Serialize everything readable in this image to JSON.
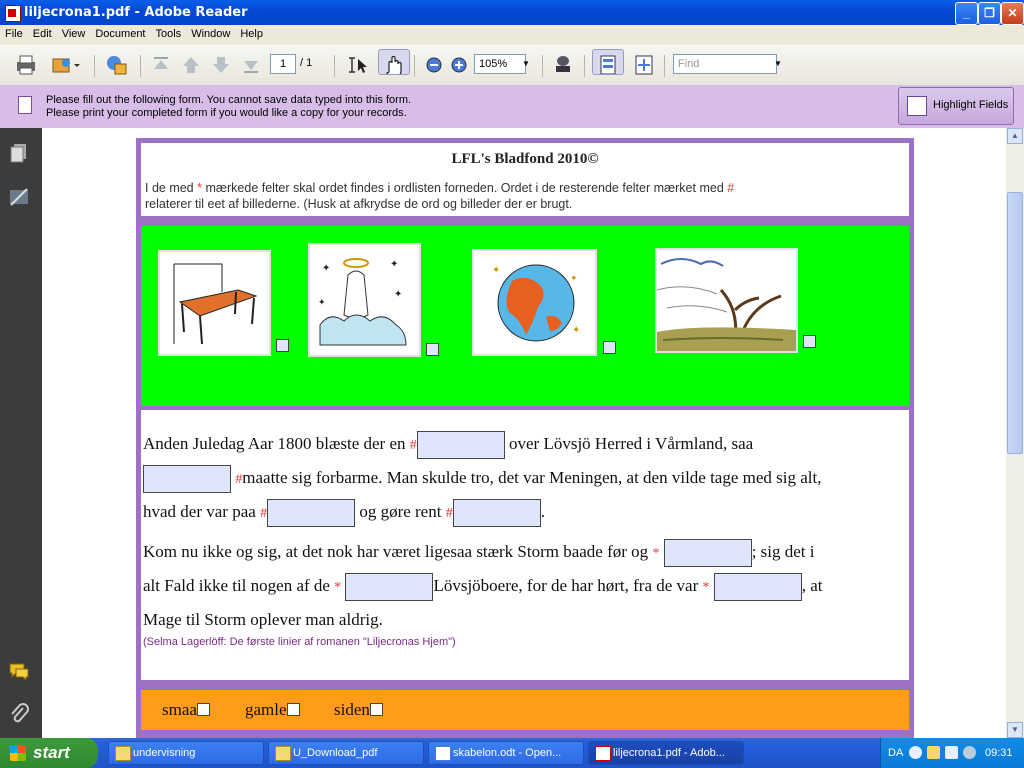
{
  "window": {
    "title": "liljecrona1.pdf - Adobe Reader"
  },
  "menu": [
    "File",
    "Edit",
    "View",
    "Document",
    "Tools",
    "Window",
    "Help"
  ],
  "toolbar": {
    "page_current": "1",
    "page_total": "/ 1",
    "zoom": "105%",
    "find_placeholder": "Find"
  },
  "message": {
    "line1": "Please fill out the following form. You cannot save data typed into this form.",
    "line2": "Please print your completed form if you would like a copy for your records.",
    "highlight_label": "Highlight Fields"
  },
  "form": {
    "title": "LFL's Bladfond 2010©",
    "intro_a": "I de med ",
    "intro_ast": "*",
    "intro_b": " mærkede felter skal ordet findes i ordlisten forneden. Ordet i de resterende felter mærket med ",
    "intro_hash": "#",
    "intro_c": "relaterer til eet af billederne.  (Husk at afkrydse de ord og billeder der er brugt.",
    "images": [
      "table",
      "angel",
      "earth",
      "storm"
    ],
    "para1": {
      "t1": "Anden Juledag Aar 1800 blæste der en ",
      "t2": " over Lövsjö Herred i Vårmland, saa",
      "t3": "maatte sig forbarme. Man skulde tro, det var Meningen, at den vilde tage med sig alt,",
      "t4": "hvad der var paa ",
      "t5": " og gøre rent ",
      "t6": "."
    },
    "para2": {
      "t1": " Kom nu ikke og sig, at det nok har været ligesaa stærk Storm baade før og ",
      "t2": "; sig det i",
      "t3": "alt Fald ikke til nogen af de ",
      "t4": "Lövsjöboere, for de har hørt, fra de var ",
      "t5": ", at",
      "t6": "Mage til Storm oplever man aldrig."
    },
    "citation": "(Selma Lagerlöff: De første linier af romanen \"Liljecronas Hjem\")",
    "words": [
      "smaa",
      "gamle",
      "siden"
    ]
  },
  "taskbar": {
    "start": "start",
    "tasks": [
      "undervisning",
      "U_Download_pdf",
      "skabelon.odt - Open...",
      "liljecrona1.pdf - Adob..."
    ],
    "lang": "DA",
    "clock": "09:31"
  }
}
